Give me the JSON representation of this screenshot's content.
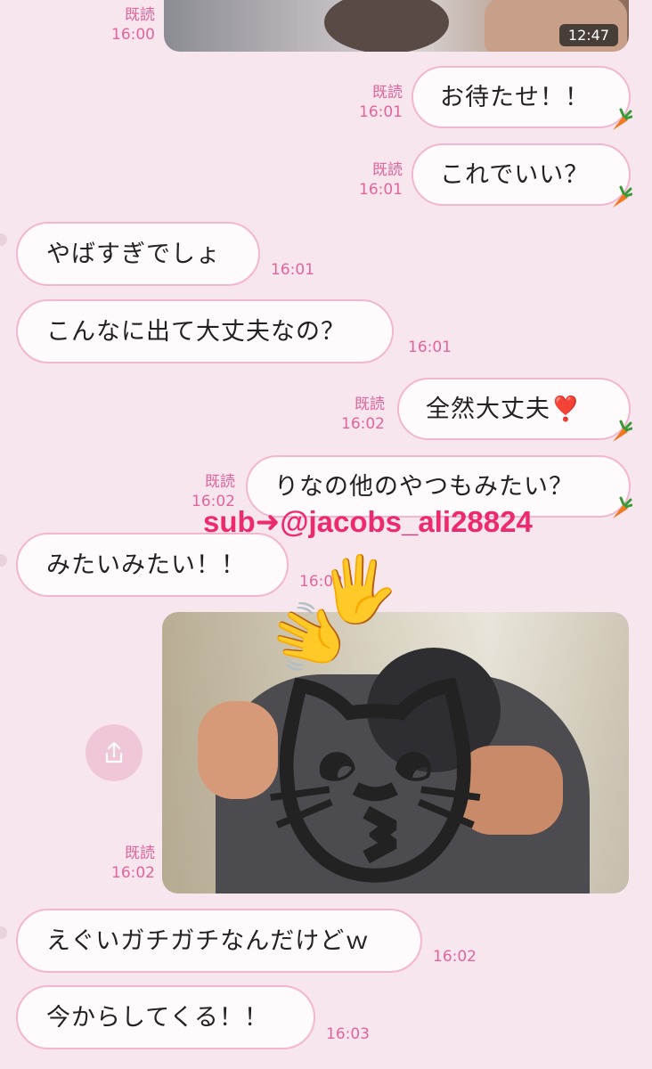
{
  "top_video": {
    "duration": "12:47",
    "meta": {
      "read": "既読",
      "time": "16:00"
    }
  },
  "messages": [
    {
      "id": "m1",
      "side": "right",
      "text": "お待たせ！！",
      "read": "既読",
      "time": "16:01"
    },
    {
      "id": "m2",
      "side": "right",
      "text": "これでいい？",
      "read": "既読",
      "time": "16:01"
    },
    {
      "id": "m3",
      "side": "left",
      "text": "やばすぎでしょ",
      "time": "16:01"
    },
    {
      "id": "m4",
      "side": "left",
      "text": "こんなに出て大丈夫なの？",
      "time": "16:01"
    },
    {
      "id": "m5",
      "side": "right",
      "text": "全然大丈夫❣️",
      "read": "既読",
      "time": "16:02"
    },
    {
      "id": "m6",
      "side": "right",
      "text": "りなの他のやつもみたい？",
      "read": "既読",
      "time": "16:02"
    },
    {
      "id": "m7",
      "side": "left",
      "text": "みたいみたい！！",
      "time": "16:02"
    },
    {
      "id": "m9",
      "side": "left",
      "text": "えぐいガチガチなんだけどｗ",
      "time": "16:02"
    },
    {
      "id": "m10",
      "side": "left",
      "text": "今からしてくる！！",
      "time": "16:03"
    }
  ],
  "photo": {
    "meta": {
      "read": "既読",
      "time": "16:02"
    }
  },
  "overlay": {
    "text": "sub➜@jacobs_ali28824"
  },
  "icons": {
    "carrot": "carrot-icon",
    "share": "share-icon",
    "hand": "raised-hand-emoji",
    "cat": "kissing-cat-emoji"
  },
  "colors": {
    "background": "#f8e6ef",
    "bubble_border": "#f3b6cf",
    "meta": "#e2659a",
    "overlay": "#ee2a6e"
  }
}
